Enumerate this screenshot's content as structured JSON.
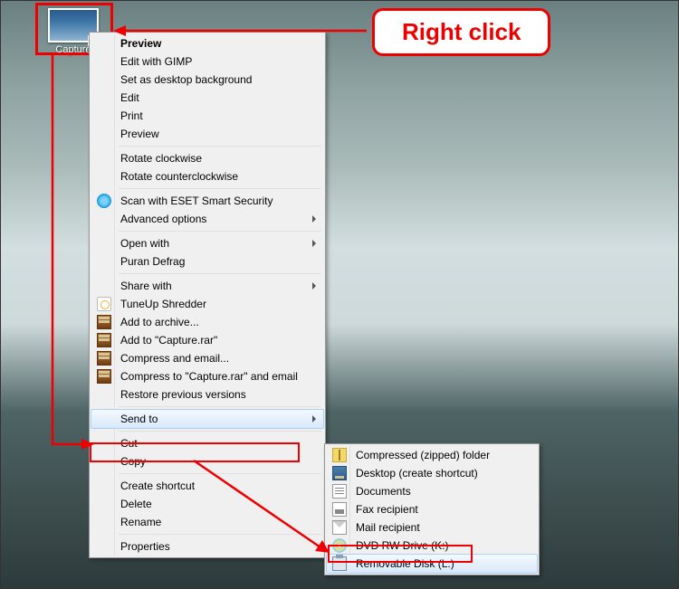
{
  "callout": {
    "label": "Right click"
  },
  "desktop_icon": {
    "label": "Capture"
  },
  "context_menu": {
    "groups": [
      {
        "items": [
          {
            "id": "preview-bold",
            "label": "Preview",
            "bold": true
          },
          {
            "id": "edit-gimp",
            "label": "Edit with GIMP"
          },
          {
            "id": "set-bg",
            "label": "Set as desktop background"
          },
          {
            "id": "edit",
            "label": "Edit"
          },
          {
            "id": "print",
            "label": "Print"
          },
          {
            "id": "preview",
            "label": "Preview"
          }
        ]
      },
      {
        "items": [
          {
            "id": "rot-cw",
            "label": "Rotate clockwise"
          },
          {
            "id": "rot-ccw",
            "label": "Rotate counterclockwise"
          }
        ]
      },
      {
        "items": [
          {
            "id": "eset",
            "label": "Scan with ESET Smart Security",
            "icon": "eset"
          },
          {
            "id": "adv-opt",
            "label": "Advanced options",
            "submenu": true
          }
        ]
      },
      {
        "items": [
          {
            "id": "open-with",
            "label": "Open with",
            "submenu": true
          },
          {
            "id": "puran",
            "label": "Puran Defrag"
          }
        ]
      },
      {
        "items": [
          {
            "id": "share-with",
            "label": "Share with",
            "submenu": true
          },
          {
            "id": "tuneup",
            "label": "TuneUp Shredder",
            "icon": "tuneup"
          },
          {
            "id": "add-arch",
            "label": "Add to archive...",
            "icon": "rar"
          },
          {
            "id": "add-capture",
            "label": "Add to \"Capture.rar\"",
            "icon": "rar"
          },
          {
            "id": "compr-email",
            "label": "Compress and email...",
            "icon": "rar"
          },
          {
            "id": "compr-cap",
            "label": "Compress to \"Capture.rar\" and email",
            "icon": "rar"
          },
          {
            "id": "restore",
            "label": "Restore previous versions"
          }
        ]
      },
      {
        "items": [
          {
            "id": "send-to",
            "label": "Send to",
            "submenu": true,
            "highlight": true
          }
        ]
      },
      {
        "items": [
          {
            "id": "cut",
            "label": "Cut"
          },
          {
            "id": "copy",
            "label": "Copy"
          }
        ]
      },
      {
        "items": [
          {
            "id": "shortcut",
            "label": "Create shortcut"
          },
          {
            "id": "delete",
            "label": "Delete"
          },
          {
            "id": "rename",
            "label": "Rename"
          }
        ]
      },
      {
        "items": [
          {
            "id": "props",
            "label": "Properties"
          }
        ]
      }
    ]
  },
  "sendto_menu": {
    "items": [
      {
        "id": "zip",
        "label": "Compressed (zipped) folder",
        "icon": "zip"
      },
      {
        "id": "desktop",
        "label": "Desktop (create shortcut)",
        "icon": "desktop"
      },
      {
        "id": "docs",
        "label": "Documents",
        "icon": "doc"
      },
      {
        "id": "fax",
        "label": "Fax recipient",
        "icon": "fax"
      },
      {
        "id": "mail",
        "label": "Mail recipient",
        "icon": "mail"
      },
      {
        "id": "dvd",
        "label": "DVD RW Drive (K:)",
        "icon": "dvd"
      },
      {
        "id": "usb",
        "label": "Removable Disk (L:)",
        "icon": "usb",
        "highlight": true
      }
    ]
  }
}
